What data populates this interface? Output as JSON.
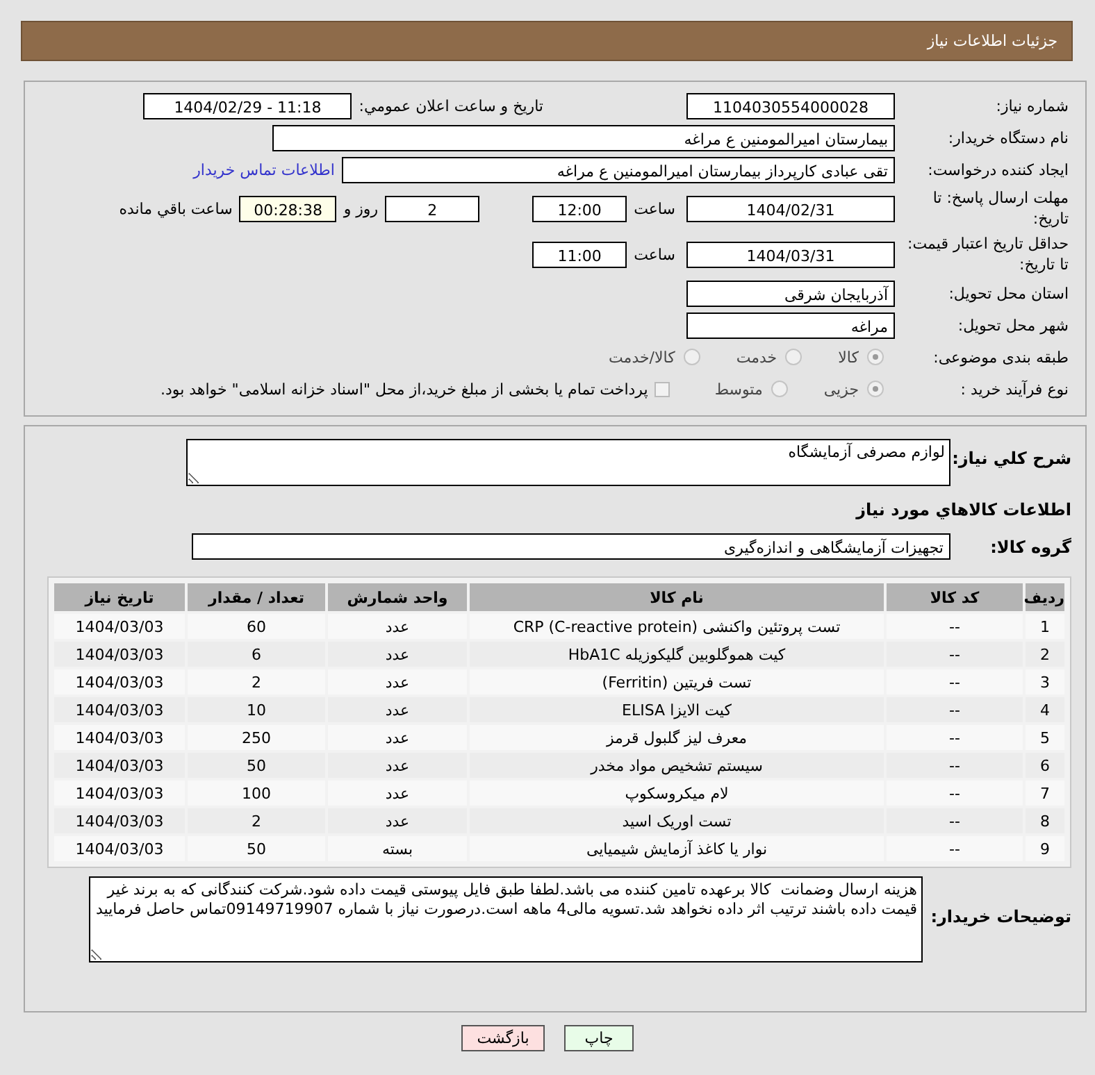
{
  "header": {
    "title": "جزئیات اطلاعات نیاز"
  },
  "details": {
    "need_number": {
      "label": "شماره نیاز:",
      "value": "1104030554000028"
    },
    "announce": {
      "label": "تاریخ و ساعت اعلان عمومي:",
      "value": "1404/02/29 - 11:18"
    },
    "buyer_org": {
      "label": "نام دستگاه خریدار:",
      "value": "بیمارستان امیرالمومنین ع  مراغه"
    },
    "requester": {
      "label": "ایجاد کننده درخواست:",
      "value": "تقی عبادی کارپرداز بیمارستان امیرالمومنین ع  مراغه",
      "link": "اطلاعات تماس خریدار"
    },
    "deadline": {
      "label": "مهلت ارسال پاسخ: تا تاریخ:",
      "date": "1404/02/31",
      "time_label": "ساعت",
      "time": "12:00",
      "days": "2",
      "days_label": "روز و",
      "remaining": "00:28:38",
      "remaining_label": "ساعت باقي مانده"
    },
    "validity": {
      "label": "حداقل تاریخ اعتبار قیمت: تا تاریخ:",
      "date": "1404/03/31",
      "time_label": "ساعت",
      "time": "11:00"
    },
    "province": {
      "label": "استان محل تحویل:",
      "value": "آذربایجان شرقی"
    },
    "city": {
      "label": "شهر محل تحویل:",
      "value": "مراغه"
    },
    "category": {
      "label": "طبقه بندی موضوعی:",
      "options": [
        {
          "label": "کالا",
          "selected": true
        },
        {
          "label": "خدمت",
          "selected": false
        },
        {
          "label": "کالا/خدمت",
          "selected": false
        }
      ]
    },
    "process": {
      "label": "نوع فرآیند خرید :",
      "options": [
        {
          "label": "جزیی",
          "selected": true
        },
        {
          "label": "متوسط",
          "selected": false
        }
      ],
      "treasury": {
        "checked": false,
        "label": "پرداخت تمام یا بخشی از مبلغ خرید،از محل \"اسناد خزانه اسلامی\" خواهد بود."
      }
    }
  },
  "description": {
    "label": "شرح کلي نیاز:",
    "value": "لوازم مصرفی آزمایشگاه"
  },
  "goods_heading": "اطلاعات کالاهاي مورد نیاز",
  "goods_group": {
    "label": "گروه کالا:",
    "value": "تجهیزات آزمایشگاهی و اندازه‌گیری"
  },
  "table": {
    "columns": [
      "ردیف",
      "کد کالا",
      "نام کالا",
      "واحد شمارش",
      "تعداد / مقدار",
      "تاریخ نیاز"
    ],
    "rows": [
      [
        "1",
        "--",
        "تست پروتئین واکنشی (CRP (C-reactive protein",
        "عدد",
        "60",
        "1404/03/03"
      ],
      [
        "2",
        "--",
        "کیت هموگلوبین گلیکوزیله HbA1C",
        "عدد",
        "6",
        "1404/03/03"
      ],
      [
        "3",
        "--",
        "تست فریتین (Ferritin)",
        "عدد",
        "2",
        "1404/03/03"
      ],
      [
        "4",
        "--",
        "کیت الایزا ELISA",
        "عدد",
        "10",
        "1404/03/03"
      ],
      [
        "5",
        "--",
        "معرف لیز گلبول قرمز",
        "عدد",
        "250",
        "1404/03/03"
      ],
      [
        "6",
        "--",
        "سیستم تشخیص مواد مخدر",
        "عدد",
        "50",
        "1404/03/03"
      ],
      [
        "7",
        "--",
        "لام میکروسکوپ",
        "عدد",
        "100",
        "1404/03/03"
      ],
      [
        "8",
        "--",
        "تست اوریک اسید",
        "عدد",
        "2",
        "1404/03/03"
      ],
      [
        "9",
        "--",
        "نوار یا کاغذ آزمایش شیمیایی",
        "بسته",
        "50",
        "1404/03/03"
      ]
    ]
  },
  "buyer_notes": {
    "label": "توضیحات خریدار:",
    "value": "هزینه ارسال وضمانت  کالا برعهده تامین کننده می باشد.لطفا طبق فایل پیوستی قیمت داده شود.شرکت کنندگانی که به برند غیر قیمت داده باشند ترتیب اثر داده نخواهد شد.تسویه مالی4 ماهه است.درصورت نیاز با شماره 09149719907تماس حاصل فرمایید"
  },
  "buttons": [
    {
      "label": "چاپ",
      "kind": "print"
    },
    {
      "label": "بازگشت",
      "kind": "back"
    }
  ]
}
